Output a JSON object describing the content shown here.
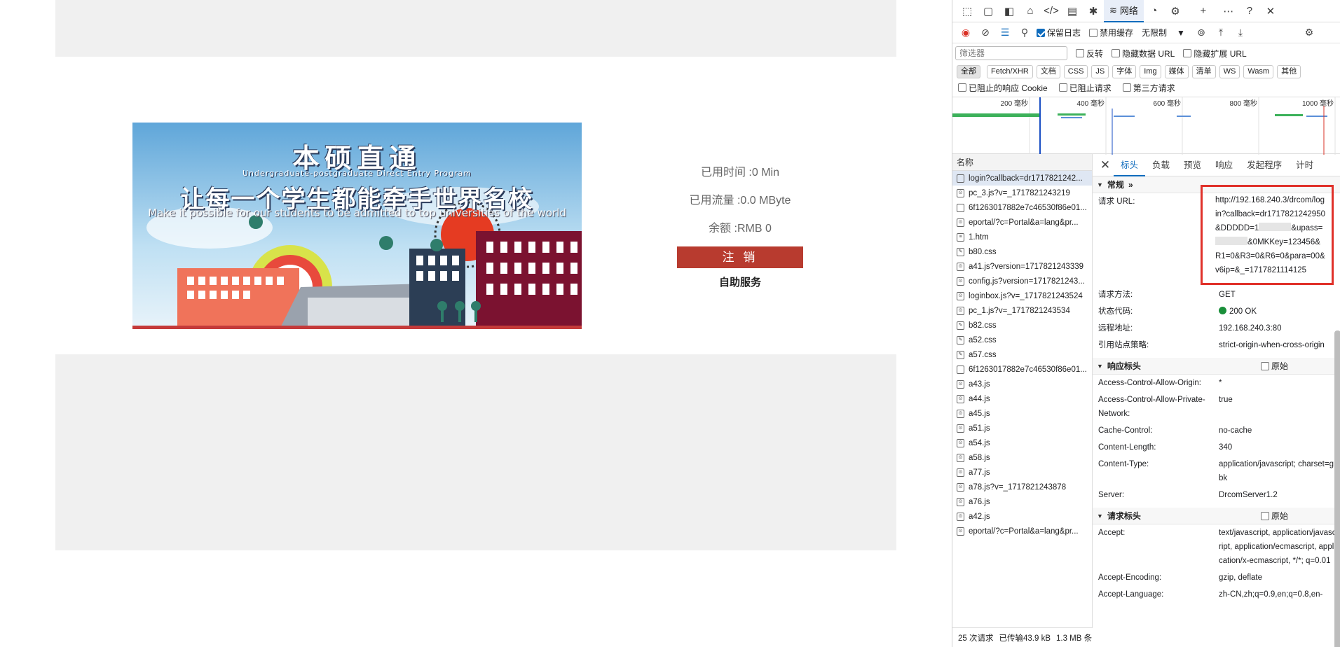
{
  "portal": {
    "banner": {
      "title": "本硕直通",
      "subtitle": "Undergraduate-postgraduate Direct Entry Program",
      "slogan": "让每一个学生都能牵手世界名校",
      "english": "Make it possible for our students to be admitted to top universities of the world"
    },
    "used_time": "已用时间 :0 Min",
    "used_traffic": "已用流量 :0.0 MByte",
    "balance": "余额 :RMB 0",
    "logout_label": "注 销",
    "self_service_label": "自助服务"
  },
  "devtools": {
    "tabs": {
      "network": "网络"
    },
    "toolbar": {
      "preserve_log": "保留日志",
      "disable_cache": "禁用缓存",
      "throttle": "无限制"
    },
    "filter": {
      "placeholder": "筛选器",
      "invert": "反转",
      "hide_data_urls": "隐藏数据 URL",
      "hide_ext_urls": "隐藏扩展 URL"
    },
    "types": [
      "全部",
      "Fetch/XHR",
      "文档",
      "CSS",
      "JS",
      "字体",
      "Img",
      "媒体",
      "清单",
      "WS",
      "Wasm",
      "其他"
    ],
    "blocked": {
      "blocked_cookies": "已阻止的响应 Cookie",
      "blocked_requests": "已阻止请求",
      "third_party": "第三方请求"
    },
    "timeline_ticks": [
      "200 毫秒",
      "400 毫秒",
      "600 毫秒",
      "800 毫秒",
      "1000 毫秒"
    ],
    "name_header": "名称",
    "requests": [
      "login?callback=dr1717821242...",
      "pc_3.js?v=_1717821243219",
      "6f1263017882e7c46530f86e01...",
      "eportal/?c=Portal&a=lang&pr...",
      "1.htm",
      "b80.css",
      "a41.js?version=1717821243339",
      "config.js?version=1717821243...",
      "loginbox.js?v=_1717821243524",
      "pc_1.js?v=_1717821243534",
      "b82.css",
      "a52.css",
      "a57.css",
      "6f1263017882e7c46530f86e01...",
      "a43.js",
      "a44.js",
      "a45.js",
      "a51.js",
      "a54.js",
      "a58.js",
      "a77.js",
      "a78.js?v=_1717821243878",
      "a76.js",
      "a42.js",
      "eportal/?c=Portal&a=lang&pr..."
    ],
    "status": {
      "requests": "25 次请求",
      "transferred": "已传输43.9 kB",
      "resources": "1.3 MB 条"
    },
    "detail_tabs": [
      "标头",
      "负载",
      "预览",
      "响应",
      "发起程序",
      "计时"
    ],
    "general": {
      "title": "常规",
      "url_key": "请求 URL:",
      "url_part1": "http://192.168.240.3/drcom/login?callback=dr1717821242950&DDDDD=1",
      "url_part2": "&upass=",
      "url_part3": "&0MKKey=123456&R1=0&R3=0&R6=0&para=00&v6ip=&_=1717821114125",
      "method_key": "请求方法:",
      "method": "GET",
      "status_key": "状态代码:",
      "status": "200 OK",
      "remote_key": "远程地址:",
      "remote": "192.168.240.3:80",
      "referrer_key": "引用站点策略:",
      "referrer": "strict-origin-when-cross-origin"
    },
    "response_headers": {
      "title": "响应标头",
      "raw": "原始",
      "rows": [
        {
          "k": "Access-Control-Allow-Origin:",
          "v": "*"
        },
        {
          "k": "Access-Control-Allow-Private-Network:",
          "v": "true"
        },
        {
          "k": "Cache-Control:",
          "v": "no-cache"
        },
        {
          "k": "Content-Length:",
          "v": "340"
        },
        {
          "k": "Content-Type:",
          "v": "application/javascript; charset=gbk"
        },
        {
          "k": "Server:",
          "v": "DrcomServer1.2"
        }
      ]
    },
    "request_headers": {
      "title": "请求标头",
      "raw": "原始",
      "rows": [
        {
          "k": "Accept:",
          "v": "text/javascript, application/javascript, application/ecmascript, application/x-ecmascript, */*; q=0.01"
        },
        {
          "k": "Accept-Encoding:",
          "v": "gzip, deflate"
        },
        {
          "k": "Accept-Language:",
          "v": "zh-CN,zh;q=0.9,en;q=0.8,en-"
        }
      ]
    }
  }
}
